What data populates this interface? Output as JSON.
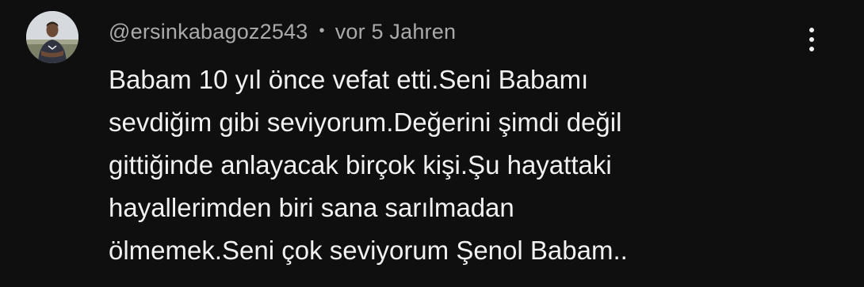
{
  "comment": {
    "author": "@ersinkabagoz2543",
    "separator": "•",
    "timestamp": "vor 5 Jahren",
    "lines": [
      "Babam 10 yıl önce vefat etti.Seni Babamı",
      "sevdiğim gibi seviyorum.Değerini şimdi değil",
      "gittiğinde anlayacak birçok kişi.Şu hayattaki",
      "hayallerimden biri sana sarılmadan",
      "ölmemek.Seni çok seviyorum Şenol Babam.."
    ],
    "avatar_icon": "user-avatar-photo",
    "menu_icon": "more-vert-icon"
  }
}
